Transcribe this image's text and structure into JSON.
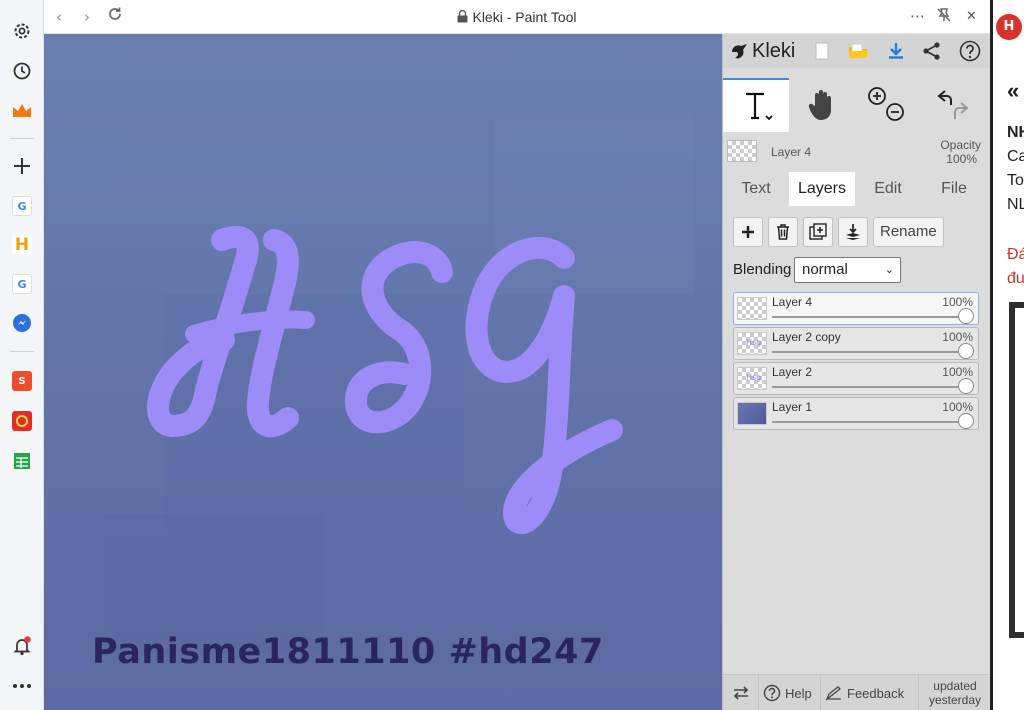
{
  "browser": {
    "title": "Kleki - Paint Tool",
    "back_icon": "chevron-left-icon",
    "forward_icon": "chevron-right-icon",
    "reload_icon": "reload-icon",
    "lock_icon": "lock-icon",
    "more_label": "⋯",
    "pin_icon": "unpin-icon",
    "close_label": "✕"
  },
  "sidebar": {
    "items": [
      {
        "icon": "gear-icon"
      },
      {
        "icon": "history-icon"
      },
      {
        "icon": "crown-icon"
      },
      {
        "icon": "plus-icon"
      },
      {
        "icon": "google-icon",
        "label": "G"
      },
      {
        "icon": "h-app-icon",
        "label": "H"
      },
      {
        "icon": "google-icon",
        "label": "G"
      },
      {
        "icon": "messenger-icon"
      },
      {
        "icon": "shopee-icon"
      },
      {
        "icon": "game-icon"
      },
      {
        "icon": "sheets-icon"
      },
      {
        "icon": "bell-icon"
      },
      {
        "icon": "more-icon"
      }
    ],
    "accent": "#e8541f"
  },
  "canvas": {
    "artwork_text": "HSG",
    "artwork_color": "#9d8cf7",
    "caption": "Panisme1811110 #hd247",
    "caption_color": "#2a2560"
  },
  "kleki": {
    "logo": "Kleki",
    "tools": [
      "text-tool-icon",
      "hand-tool-icon",
      "zoom-icon",
      "undo-redo-icon"
    ],
    "current_layer": {
      "name": "Layer 4",
      "opacity_label": "Opacity",
      "opacity_value": "100%"
    },
    "tabs": [
      "Text",
      "Layers",
      "Edit",
      "File"
    ],
    "active_tab": "Layers",
    "actions": {
      "rename": "Rename"
    },
    "blending": {
      "label": "Blending",
      "value": "normal"
    },
    "layers": [
      {
        "name": "Layer 4",
        "opacity": "100%",
        "active": true
      },
      {
        "name": "Layer 2 copy",
        "opacity": "100%",
        "active": false
      },
      {
        "name": "Layer 2",
        "opacity": "100%",
        "active": false
      },
      {
        "name": "Layer 1",
        "opacity": "100%",
        "active": false
      }
    ],
    "footer": {
      "help": "Help",
      "feedback": "Feedback",
      "updated_line1": "updated",
      "updated_line2": "yesterday"
    }
  },
  "right_page": {
    "badge": "H",
    "chevron": "«",
    "lines": [
      "NH",
      "Ca",
      "To",
      "NL"
    ],
    "red_lines": [
      "Đá",
      "đu"
    ]
  }
}
